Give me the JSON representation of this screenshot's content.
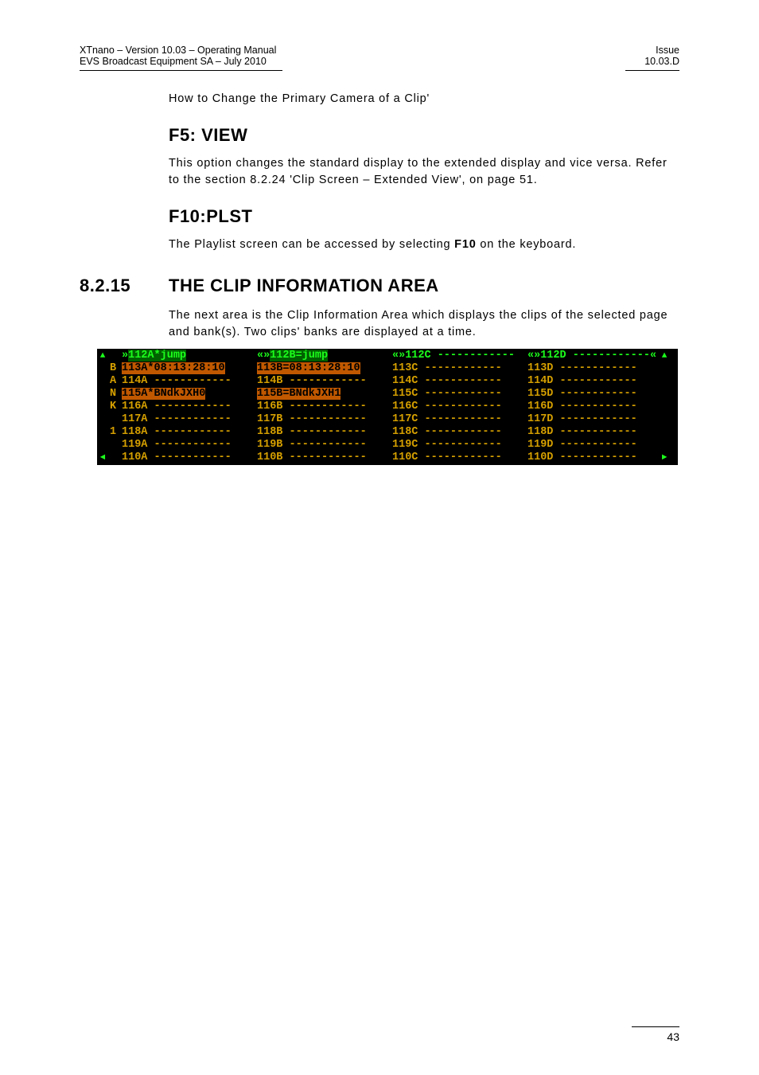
{
  "header": {
    "left_line1": "XTnano – Version 10.03 – Operating Manual",
    "left_line2": "EVS Broadcast Equipment SA – July 2010",
    "right_line1": "Issue",
    "right_line2": "10.03.D"
  },
  "para_change": "How to Change the Primary Camera of a Clip'",
  "h_f5": "F5: VIEW",
  "para_f5": "This option changes the standard display to the extended display and vice versa. Refer to the section 8.2.24 'Clip Screen – Extended View', on page 51.",
  "h_f10": "F10:PLST",
  "para_f10_pre": "The Playlist screen can be accessed by selecting ",
  "para_f10_bold": "F10",
  "para_f10_post": " on the keyboard.",
  "sec_num": "8.2.15",
  "sec_title": "THE CLIP INFORMATION AREA",
  "para_sec": "The next area is the Clip Information Area which displays the clips of the selected page and bank(s). Two clips' banks are displayed at a time.",
  "clip": {
    "letters": [
      "",
      "B",
      "A",
      "N",
      "K",
      "",
      "1",
      "",
      ""
    ],
    "rows": [
      {
        "a": {
          "t": "112A*jump",
          "hl": "greenbg",
          "link": "»"
        },
        "b": {
          "t": "112B=jump",
          "hl": "greenbg",
          "link": "«»"
        },
        "c": {
          "t": "112C ------------",
          "cls": "txt-green",
          "link": "«»"
        },
        "d": {
          "t": "112D ------------",
          "cls": "txt-green",
          "link": "«»",
          "rlink": "«"
        }
      },
      {
        "a": {
          "t": "113A*08:13:28:10",
          "hl": "orange"
        },
        "b": {
          "t": "113B=08:13:28:10",
          "hl": "orange"
        },
        "c": {
          "t": "113C ------------"
        },
        "d": {
          "t": "113D ------------"
        }
      },
      {
        "a": {
          "t": "114A ------------"
        },
        "b": {
          "t": "114B ------------"
        },
        "c": {
          "t": "114C ------------"
        },
        "d": {
          "t": "114D ------------"
        }
      },
      {
        "a": {
          "t": "115A*BNdkJXH0",
          "hl": "orange"
        },
        "b": {
          "t": "115B=BNdkJXH1",
          "hl": "orange"
        },
        "c": {
          "t": "115C ------------"
        },
        "d": {
          "t": "115D ------------"
        }
      },
      {
        "a": {
          "t": "116A ------------"
        },
        "b": {
          "t": "116B ------------"
        },
        "c": {
          "t": "116C ------------"
        },
        "d": {
          "t": "116D ------------"
        }
      },
      {
        "a": {
          "t": "117A ------------"
        },
        "b": {
          "t": "117B ------------"
        },
        "c": {
          "t": "117C ------------"
        },
        "d": {
          "t": "117D ------------"
        }
      },
      {
        "a": {
          "t": "118A ------------"
        },
        "b": {
          "t": "118B ------------"
        },
        "c": {
          "t": "118C ------------"
        },
        "d": {
          "t": "118D ------------"
        }
      },
      {
        "a": {
          "t": "119A ------------"
        },
        "b": {
          "t": "119B ------------"
        },
        "c": {
          "t": "119C ------------"
        },
        "d": {
          "t": "119D ------------"
        }
      },
      {
        "a": {
          "t": "110A ------------"
        },
        "b": {
          "t": "110B ------------"
        },
        "c": {
          "t": "110C ------------"
        },
        "d": {
          "t": "110D ------------"
        }
      }
    ]
  },
  "page_number": "43"
}
